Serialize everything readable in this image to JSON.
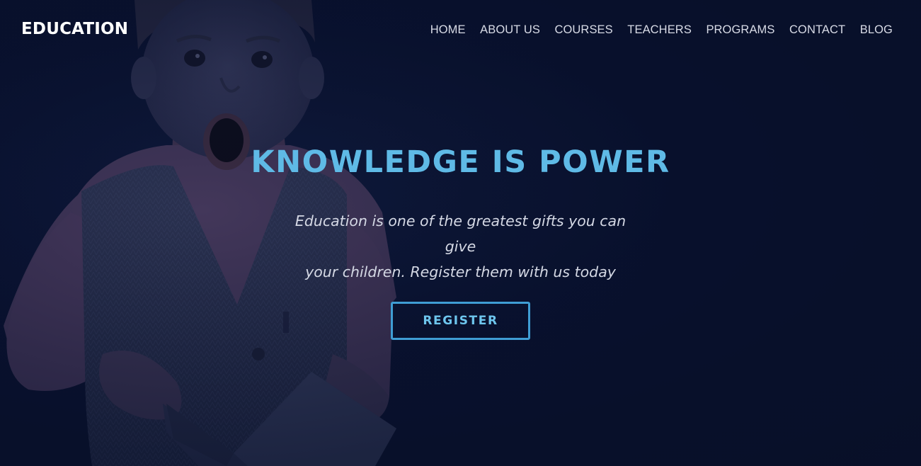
{
  "header": {
    "brand": "EDUCATION",
    "nav": [
      {
        "id": "home",
        "label": "HOME"
      },
      {
        "id": "about-us",
        "label": "ABOUT US"
      },
      {
        "id": "courses",
        "label": "COURSES"
      },
      {
        "id": "teachers",
        "label": "TEACHERS"
      },
      {
        "id": "programs",
        "label": "PROGRAMS"
      },
      {
        "id": "contact",
        "label": "CONTACT"
      },
      {
        "id": "blog",
        "label": "BLOG"
      }
    ]
  },
  "hero": {
    "headline": "KNOWLEDGE IS POWER",
    "subtitle_line1": "Education is one of the greatest gifts you can give",
    "subtitle_line2": "your children. Register them with us today",
    "cta_label": "REGISTER"
  },
  "theme": {
    "background": "#081029",
    "accent": "#5fbae6",
    "button_border": "#3f9dd4",
    "nav_text": "#d8dbe6",
    "brand_text": "#ffffff"
  }
}
